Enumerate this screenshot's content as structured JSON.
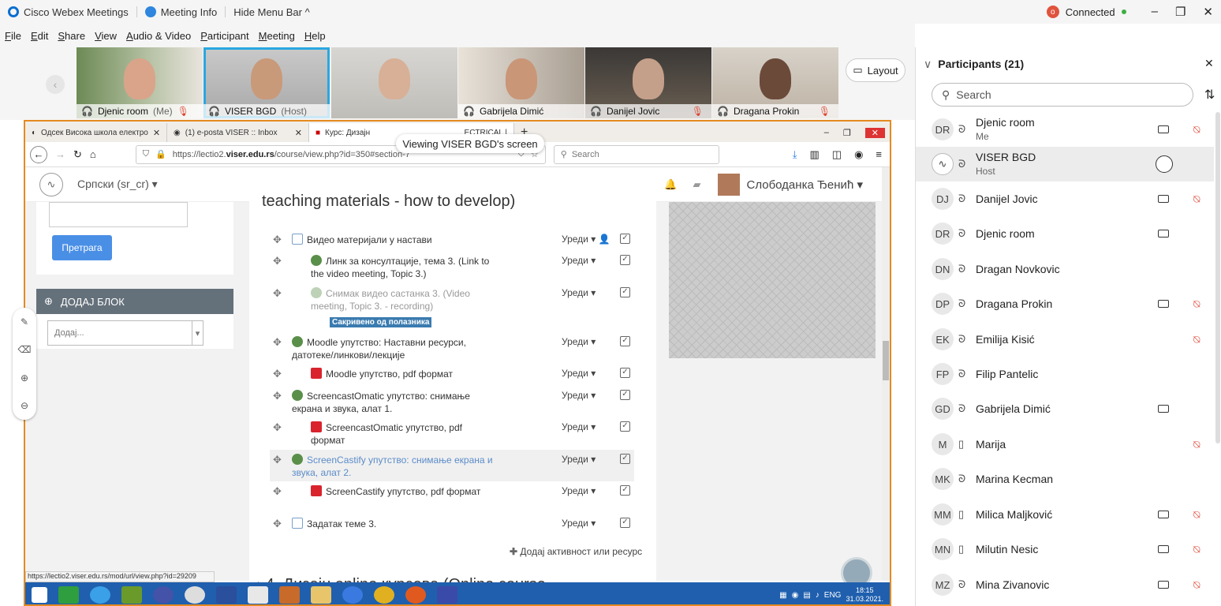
{
  "titlebar": {
    "app_name": "Cisco Webex Meetings",
    "meeting_info": "Meeting Info",
    "hide_menu": "Hide Menu Bar ^",
    "connected": "Connected",
    "badge": "o"
  },
  "menu": [
    "File",
    "Edit",
    "Share",
    "View",
    "Audio & Video",
    "Participant",
    "Meeting",
    "Help"
  ],
  "video_tiles": [
    {
      "name": "Djenic room",
      "suffix": "(Me)",
      "muted": true,
      "selected": false
    },
    {
      "name": "VISER BGD",
      "suffix": "(Host)",
      "muted": false,
      "selected": true
    },
    {
      "name": "",
      "suffix": "",
      "muted": false,
      "selected": false
    },
    {
      "name": "Gabrijela Dimić",
      "suffix": "",
      "muted": false,
      "selected": false
    },
    {
      "name": "Danijel Jovic",
      "suffix": "",
      "muted": true,
      "selected": false
    },
    {
      "name": "Dragana Prokin",
      "suffix": "",
      "muted": true,
      "selected": false
    }
  ],
  "layout_label": "Layout",
  "shared": {
    "viewing": "Viewing VISER BGD's screen",
    "tabs": [
      "Одсек Висока школа електро",
      "(1) e-posta VISER :: Inbox",
      "Курс: Дизајн",
      "ECTRICAL |"
    ],
    "url_prefix": "https://lectio2.",
    "url_domain": "viser.edu.rs",
    "url_path": "/course/view.php?id=350#section-7",
    "search_placeholder": "Search",
    "language": "Српски (sr_cr)",
    "user": "Слободанка Ђенић",
    "section_title": "teaching materials - how to develop)",
    "search_button": "Претрага",
    "add_block": "ДОДАЈ БЛОК",
    "add_select": "Додај...",
    "edit_label": "Уреди",
    "hidden_badge": "Сакривено од полазника",
    "add_activity": "Додај активност или ресурс",
    "next_section": "4. Дизајн online курсева (Online course",
    "status_url": "https://lectio2.viser.edu.rs/mod/url/view.php?id=29209",
    "taskbar_lang": "ENG",
    "taskbar_time": "18:15",
    "taskbar_date": "31.03.2021.",
    "activities": [
      {
        "icon": "folder",
        "text": "Видео материјали у настави",
        "indent": 0
      },
      {
        "icon": "url",
        "text": "Линк за консултације, тема 3. (Link to the video meeting, Topic 3.)",
        "indent": 1
      },
      {
        "icon": "url",
        "text": "Снимак видео састанка 3. (Video meeting, Topic 3. - recording)",
        "indent": 1
      },
      {
        "icon": "url",
        "text": "Moodle упутство: Наставни ресурси, датотеке/линкови/лекције",
        "indent": 0
      },
      {
        "icon": "pdf",
        "text": "Moodle упутство, pdf формат",
        "indent": 1
      },
      {
        "icon": "url",
        "text": "ScreencastOmatic упутство: снимање екрана и звука, алат 1.",
        "indent": 0
      },
      {
        "icon": "pdf",
        "text": "ScreencastOmatic упутство, pdf формат",
        "indent": 1
      },
      {
        "icon": "url",
        "text": "ScreenCastify упутство: снимање екрана и звука, алат 2.",
        "indent": 0
      },
      {
        "icon": "pdf",
        "text": "ScreenCastify упутство, pdf формат",
        "indent": 1
      },
      {
        "icon": "doc",
        "text": "Задатак теме 3.",
        "indent": 0
      }
    ]
  },
  "participants": {
    "title": "Participants (21)",
    "search_placeholder": "Search",
    "list": [
      {
        "initials": "DR",
        "name": "Djenic room",
        "role": "Me",
        "cam": true,
        "muted": true
      },
      {
        "initials": "",
        "name": "VISER BGD",
        "role": "Host",
        "cam": false,
        "muted": false
      },
      {
        "initials": "DJ",
        "name": "Danijel Jovic",
        "role": "",
        "cam": true,
        "muted": true
      },
      {
        "initials": "DR",
        "name": "Djenic room",
        "role": "",
        "cam": true,
        "muted": false
      },
      {
        "initials": "DN",
        "name": "Dragan Novkovic",
        "role": "",
        "cam": false,
        "muted": false
      },
      {
        "initials": "DP",
        "name": "Dragana Prokin",
        "role": "",
        "cam": true,
        "muted": true
      },
      {
        "initials": "EK",
        "name": "Emilija Kisić",
        "role": "",
        "cam": false,
        "muted": true
      },
      {
        "initials": "FP",
        "name": "Filip Pantelic",
        "role": "",
        "cam": false,
        "muted": false
      },
      {
        "initials": "GD",
        "name": "Gabrijela Dimić",
        "role": "",
        "cam": true,
        "muted": false
      },
      {
        "initials": "M",
        "name": "Marija",
        "role": "",
        "cam": false,
        "muted": true
      },
      {
        "initials": "MK",
        "name": "Marina Kecman",
        "role": "",
        "cam": false,
        "muted": false
      },
      {
        "initials": "MM",
        "name": "Milica Maljković",
        "role": "",
        "cam": true,
        "muted": true
      },
      {
        "initials": "MN",
        "name": "Milutin Nesic",
        "role": "",
        "cam": true,
        "muted": true
      },
      {
        "initials": "MZ",
        "name": "Mina Zivanovic",
        "role": "",
        "cam": true,
        "muted": true
      }
    ]
  }
}
